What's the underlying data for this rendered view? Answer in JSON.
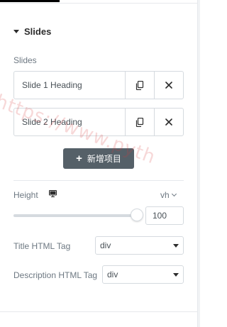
{
  "section": {
    "title": "Slides"
  },
  "slides_control": {
    "label": "Slides",
    "items": [
      {
        "title": "Slide 1 Heading"
      },
      {
        "title": "Slide 2 Heading"
      }
    ],
    "add_button_label": "新增项目",
    "add_icon": "+"
  },
  "height_control": {
    "label": "Height",
    "device_icon": "desktop-monitor-icon",
    "unit": "vh",
    "value": "100",
    "slider_fraction": 1.0
  },
  "title_tag_control": {
    "label": "Title HTML Tag",
    "selected": "div"
  },
  "description_tag_control": {
    "label": "Description HTML Tag",
    "selected": "div"
  },
  "watermark": {
    "text": "https://www.pyth"
  },
  "colors": {
    "add_button_bg": "#556068",
    "border": "#d5dadf",
    "text": "#495157",
    "label": "#6d7882",
    "watermark": "#d63c3c"
  }
}
